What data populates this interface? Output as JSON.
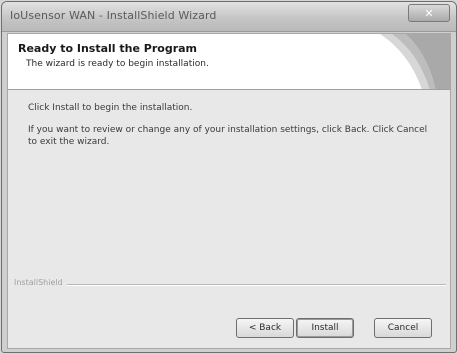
{
  "window": {
    "title": "IoUsensor WAN - InstallShield Wizard",
    "close_glyph": "✕"
  },
  "header": {
    "title": "Ready to Install the Program",
    "subtitle": "The wizard is ready to begin installation."
  },
  "body": {
    "line1": "Click Install to begin the installation.",
    "line2": "If you want to review or change any of your installation settings, click Back. Click Cancel to exit the wizard."
  },
  "brand": {
    "label": "InstallShield"
  },
  "buttons": {
    "back": "< Back",
    "install": "Install",
    "cancel": "Cancel"
  },
  "colors": {
    "titlebar": "#c6c6c6",
    "client_bg": "#e8e8e8",
    "header_bg": "#ffffff"
  }
}
